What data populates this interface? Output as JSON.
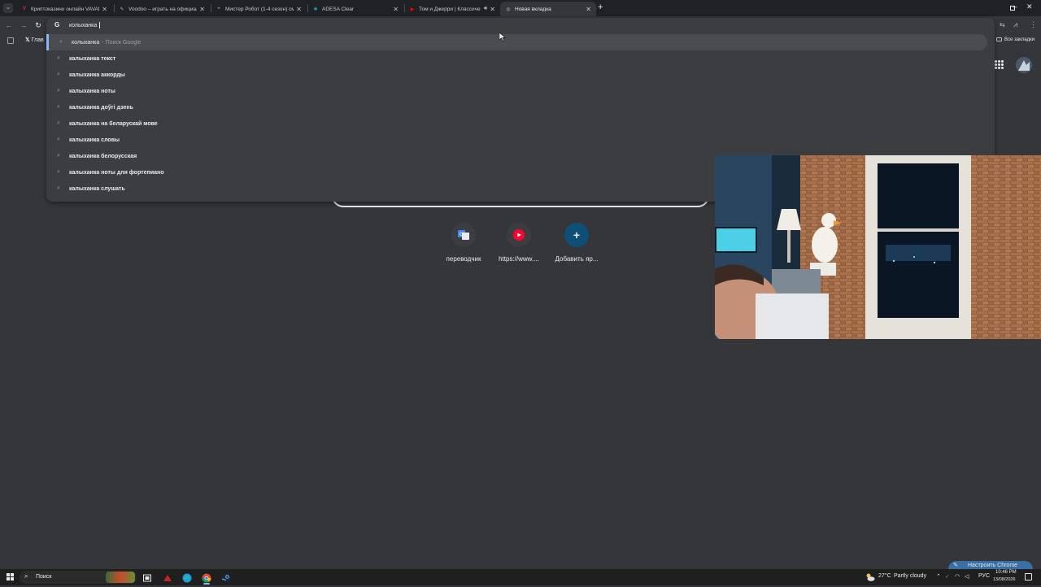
{
  "tabs": [
    {
      "title": "Криптоказино онлайн VAVADA",
      "fav_color": "#e0245e",
      "fav_glyph": "V"
    },
    {
      "title": "Voodoo – играть на официальн",
      "fav_color": "#3a7bd5",
      "fav_glyph": "✎"
    },
    {
      "title": "Мистер Робот (1-4 сезон) смо",
      "fav_color": "#6f7780",
      "fav_glyph": "◓"
    },
    {
      "title": "ADESA Clear",
      "fav_color": "#1aa0b8",
      "fav_glyph": "✱"
    },
    {
      "title": "Том и Джерри | Классиче",
      "fav_color": "#ff0000",
      "fav_glyph": "▶"
    },
    {
      "title": "Новая вкладка",
      "fav_color": "#9aa0a6",
      "fav_glyph": "◎"
    }
  ],
  "omnibox": {
    "input": "колыханка",
    "top_suggestion": {
      "text": "колыханка",
      "suffix": "- Поиск Google"
    },
    "suggestions": [
      "калыханка текст",
      "калыханка аккорды",
      "калыханка ноты",
      "калыханка доўгі дзень",
      "калыханка на беларускай мове",
      "калыханка словы",
      "калыханка белорусская",
      "калыханка ноты для фортепиано",
      "калыханка слушать"
    ]
  },
  "bookmarks": {
    "item1": "Глав",
    "all_bookmarks": "Все закладки"
  },
  "shortcuts": [
    {
      "label": "переводчик",
      "icon": "translate-icon",
      "color": "#4285f4"
    },
    {
      "label": "https://www....",
      "icon": "youtube-icon",
      "color": "#ff0000"
    },
    {
      "label": "Добавить яр...",
      "icon": "plus-icon",
      "color": "#8ab4f8"
    }
  ],
  "customize_button": "Настроить Chrome",
  "taskbar": {
    "search_placeholder": "Поиск",
    "weather_temp": "27°C",
    "weather_desc": "Partly cloudy",
    "lang": "РУС",
    "time": "10:46 PM",
    "date": "13/08/2026"
  },
  "colors": {
    "bg": "#35363a",
    "tabstrip": "#202124",
    "accent": "#8ab4f8"
  }
}
